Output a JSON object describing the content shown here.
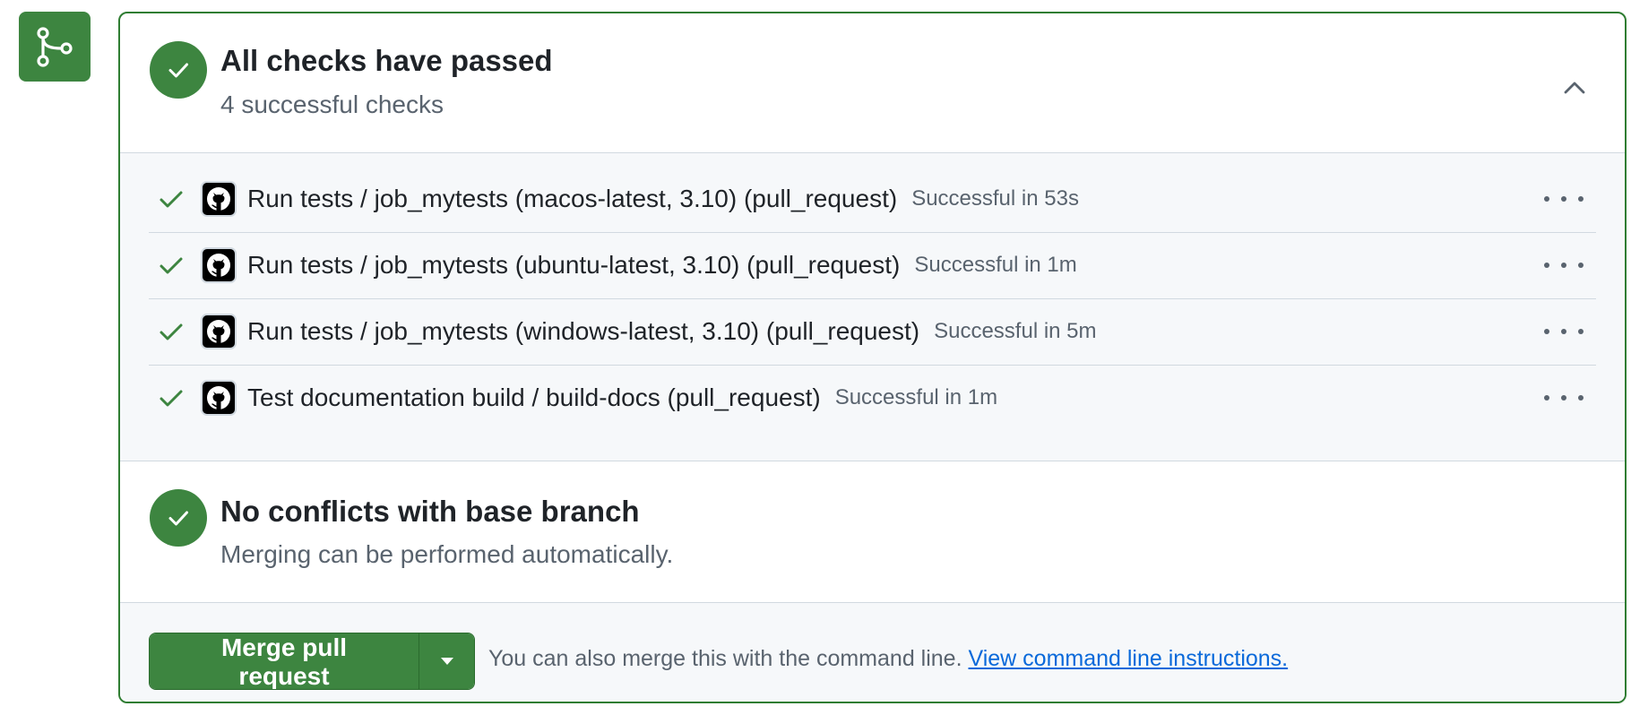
{
  "icons": {
    "merge_badge": "git-merge-icon",
    "status": "check-circle-icon",
    "collapse": "chevron-up-icon",
    "row_check": "check-icon",
    "avatar": "github-icon",
    "row_menu": "kebab-horizontal-icon",
    "dropdown": "triangle-down-icon"
  },
  "colors": {
    "success": "#3d8540",
    "link": "#0969da",
    "muted": "#59636e"
  },
  "checks": {
    "title": "All checks have passed",
    "subtitle": "4 successful checks",
    "items": [
      {
        "name": "Run tests / job_mytests (macos-latest, 3.10) (pull_request)",
        "status": "Successful in 53s"
      },
      {
        "name": "Run tests / job_mytests (ubuntu-latest, 3.10) (pull_request)",
        "status": "Successful in 1m"
      },
      {
        "name": "Run tests / job_mytests (windows-latest, 3.10) (pull_request)",
        "status": "Successful in 5m"
      },
      {
        "name": "Test documentation build / build-docs (pull_request)",
        "status": "Successful in 1m"
      }
    ]
  },
  "conflicts": {
    "title": "No conflicts with base branch",
    "subtitle": "Merging can be performed automatically."
  },
  "merge": {
    "button_label": "Merge pull request",
    "hint_text": "You can also merge this with the command line.",
    "link_text": "View command line instructions."
  }
}
